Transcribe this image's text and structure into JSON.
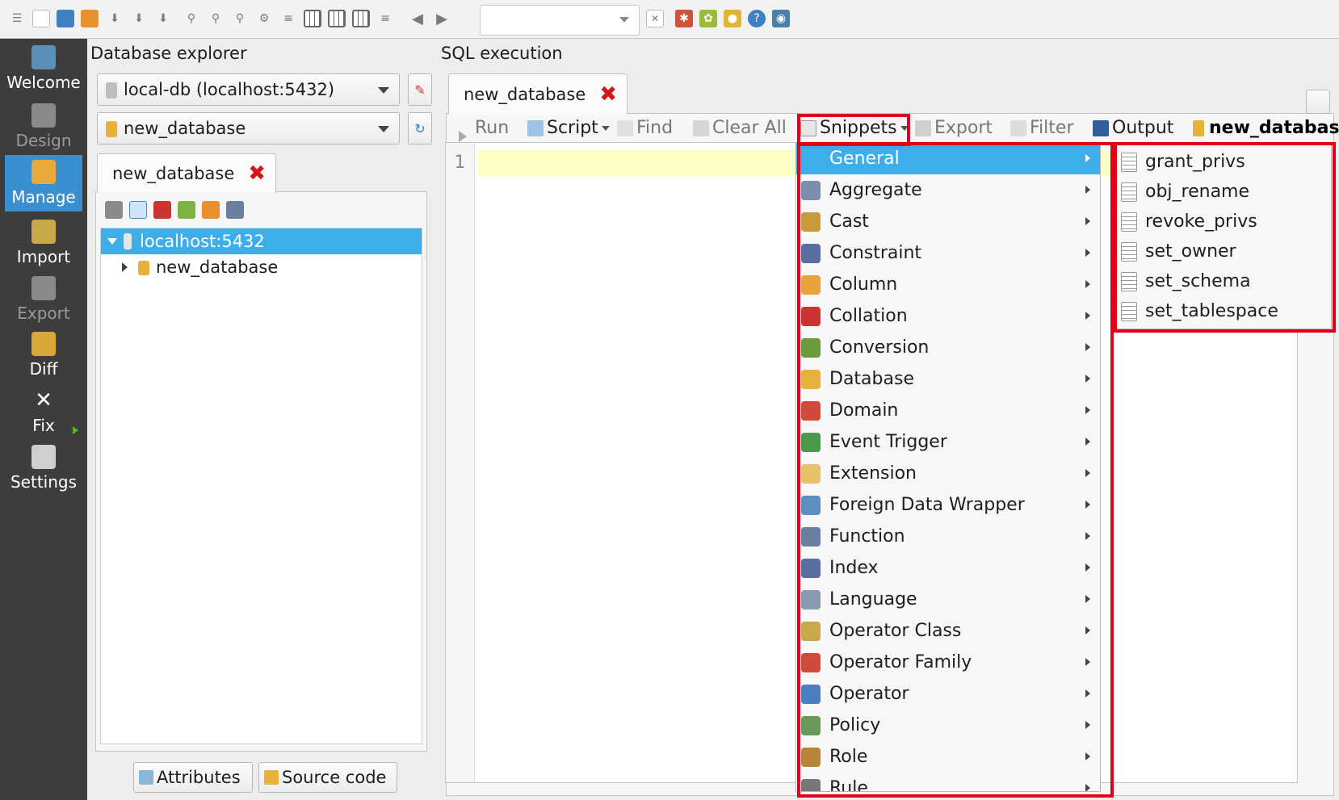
{
  "toolbar": {
    "icons": [
      "menu-icon",
      "new-file-icon",
      "open-folder-icon",
      "open-recent-icon",
      "save-icon",
      "save-as-icon",
      "save-all-icon",
      "zoom-in-icon",
      "zoom-out-icon",
      "zoom-reset-icon",
      "settings-gear-icon",
      "hierarchy-icon",
      "grid-icon",
      "grid-dense-icon",
      "grid-fit-icon",
      "align-icon",
      "arrow-left-icon",
      "arrow-right-icon"
    ],
    "history_value": "",
    "right_icons": [
      "close-scene-icon",
      "plugins-icon",
      "bug-report-icon",
      "coins-icon",
      "help-icon",
      "update-icon"
    ]
  },
  "sidebar": {
    "items": [
      {
        "label": "Welcome",
        "icon": "welcome-icon",
        "state": "normal"
      },
      {
        "label": "Design",
        "icon": "design-icon",
        "state": "disabled"
      },
      {
        "label": "Manage",
        "icon": "manage-icon",
        "state": "active"
      },
      {
        "label": "Import",
        "icon": "import-icon",
        "state": "normal"
      },
      {
        "label": "Export",
        "icon": "export-icon",
        "state": "disabled"
      },
      {
        "label": "Diff",
        "icon": "diff-icon",
        "state": "normal"
      },
      {
        "label": "Fix",
        "icon": "fix-icon",
        "state": "normal"
      },
      {
        "label": "Settings",
        "icon": "settings-icon",
        "state": "normal"
      }
    ]
  },
  "explorer": {
    "title": "Database explorer",
    "connection": "local-db (localhost:5432)",
    "database": "new_database",
    "tab_label": "new_database",
    "tree": {
      "server": "localhost:5432",
      "database": "new_database"
    },
    "buttons": {
      "attributes": "Attributes",
      "source_code": "Source code"
    }
  },
  "sql": {
    "title": "SQL execution",
    "tab_label": "new_database",
    "line_number": "1",
    "toolbar": {
      "run": "Run",
      "script": "Script",
      "find": "Find",
      "clear_all": "Clear All",
      "snippets": "Snippets",
      "export": "Export",
      "filter": "Filter",
      "output": "Output",
      "database": "new_database"
    }
  },
  "snippets_menu": {
    "items": [
      {
        "label": "General",
        "icon": "general-icon",
        "highlighted": true
      },
      {
        "label": "Aggregate",
        "icon": "aggregate-icon"
      },
      {
        "label": "Cast",
        "icon": "cast-icon"
      },
      {
        "label": "Constraint",
        "icon": "constraint-icon"
      },
      {
        "label": "Column",
        "icon": "column-icon"
      },
      {
        "label": "Collation",
        "icon": "collation-icon"
      },
      {
        "label": "Conversion",
        "icon": "conversion-icon"
      },
      {
        "label": "Database",
        "icon": "database-icon"
      },
      {
        "label": "Domain",
        "icon": "domain-icon"
      },
      {
        "label": "Event Trigger",
        "icon": "event-trigger-icon"
      },
      {
        "label": "Extension",
        "icon": "extension-icon"
      },
      {
        "label": "Foreign Data Wrapper",
        "icon": "foreign-data-wrapper-icon"
      },
      {
        "label": "Function",
        "icon": "function-icon"
      },
      {
        "label": "Index",
        "icon": "index-icon"
      },
      {
        "label": "Language",
        "icon": "language-icon"
      },
      {
        "label": "Operator Class",
        "icon": "operator-class-icon"
      },
      {
        "label": "Operator Family",
        "icon": "operator-family-icon"
      },
      {
        "label": "Operator",
        "icon": "operator-icon"
      },
      {
        "label": "Policy",
        "icon": "policy-icon"
      },
      {
        "label": "Role",
        "icon": "role-icon"
      },
      {
        "label": "Rule",
        "icon": "rule-icon"
      }
    ]
  },
  "general_submenu": {
    "items": [
      "grant_privs",
      "obj_rename",
      "revoke_privs",
      "set_owner",
      "set_schema",
      "set_tablespace"
    ]
  },
  "colors": {
    "highlight": "#3daee9",
    "sidebar_bg": "#3d3d3d",
    "active_tab": "#3a8fd0",
    "annotation_red": "#e0001a",
    "close_red": "#d01818",
    "current_line": "#fefdc8"
  }
}
